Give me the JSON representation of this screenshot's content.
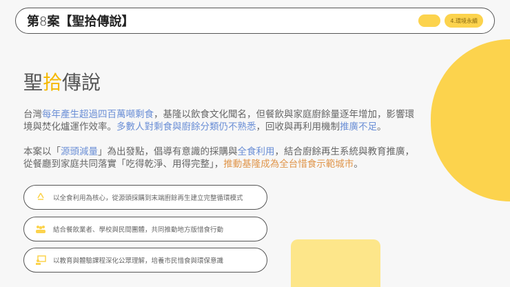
{
  "header": {
    "title_prefix": "第",
    "title_num": "8",
    "title_suffix": "案【聖拾傳說】",
    "badge": "4.環境永續"
  },
  "heading": {
    "a": "聖",
    "b": "拾",
    "c": "傳說"
  },
  "para1": [
    "台灣",
    "每年產生超過四百萬噸剩食",
    "，基隆以飲食文化聞名，但餐飲與家庭廚餘量逐年增加，影響環境與焚化爐運作效率。",
    "多數人對剩食與廚餘分類仍不熟悉",
    "，回收與再利用機制",
    "推廣不足",
    "。"
  ],
  "para2": [
    "本案以「",
    "源頭減量",
    "」為出發點，倡導有意識的採購與",
    "全食利用",
    "，結合廚餘再生系統與教育推廣，從餐廳到家庭共同落實「吃得乾淨、用得完整」，",
    "推動基隆成為全台惜食示範城市",
    "。"
  ],
  "items": [
    {
      "icon": "recycle-icon",
      "text": "以全食利用為核心，從源頭採購到末端廚餘再生建立完整循環模式"
    },
    {
      "icon": "people-icon",
      "text": "結合餐飲業者、學校與民間團體，共同推動地方版惜食行動"
    },
    {
      "icon": "presentation-icon",
      "text": "以教育與體驗課程深化公眾理解，培養市民惜食與環保意識"
    }
  ],
  "colors": {
    "accent": "#fcd34d",
    "blue": "#6b8fd6",
    "orange": "#e0954a"
  }
}
